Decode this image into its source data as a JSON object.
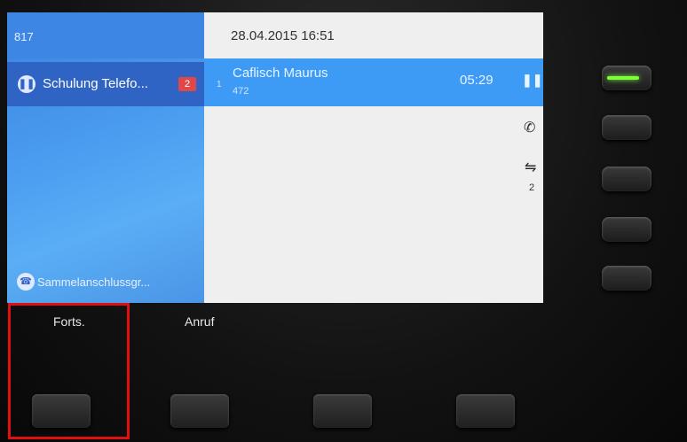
{
  "line_panel": {
    "extension": "817",
    "active_line": {
      "label": "Schulung Telefo...",
      "badge_count": "2",
      "icon": "pause-icon"
    },
    "hunt_group": {
      "label": "Sammelanschlussgr...",
      "icon": "hunt-group-icon"
    }
  },
  "call_panel": {
    "datetime": "28.04.2015 16:51",
    "call": {
      "index": "1",
      "name": "Caflisch Maurus",
      "number": "472",
      "timer": "05:29",
      "state_icon": "pause-icon"
    },
    "side_icons": {
      "handset": "phone-handset-icon",
      "transfer": "transfer-icon",
      "transfer_count": "2"
    }
  },
  "softkeys": {
    "key1": "Forts.",
    "key2": "Anruf"
  },
  "colors": {
    "left_pane": "#4a9df0",
    "active_line": "#2f63c4",
    "active_call": "#3d9af5",
    "badge": "#e04848",
    "highlight": "#e01010",
    "led": "#7dff3a"
  }
}
